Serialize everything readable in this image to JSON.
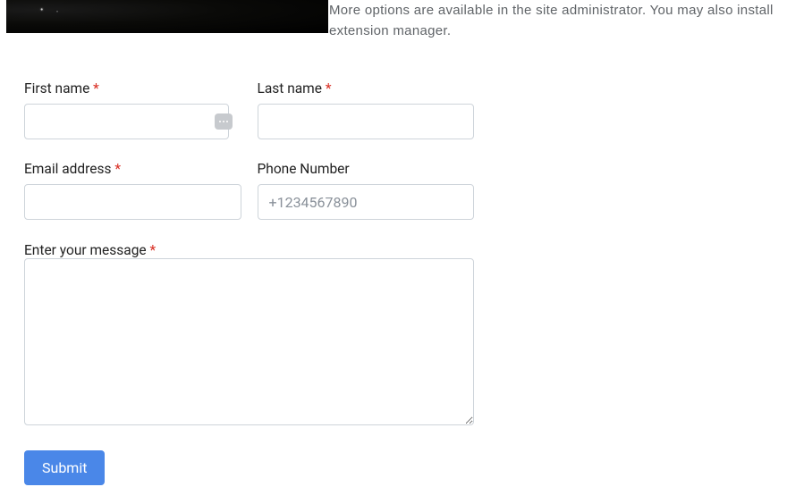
{
  "intro_text": "More options are available in the site administrator. You may also install extension manager.",
  "form": {
    "first_name": {
      "label": "First name",
      "required": "*",
      "value": ""
    },
    "last_name": {
      "label": "Last name",
      "required": "*",
      "value": ""
    },
    "email": {
      "label": "Email address",
      "required": "*",
      "value": ""
    },
    "phone": {
      "label": "Phone Number",
      "placeholder": "+1234567890",
      "value": ""
    },
    "message": {
      "label": "Enter your message",
      "required": "*",
      "value": ""
    },
    "submit_label": "Submit"
  }
}
